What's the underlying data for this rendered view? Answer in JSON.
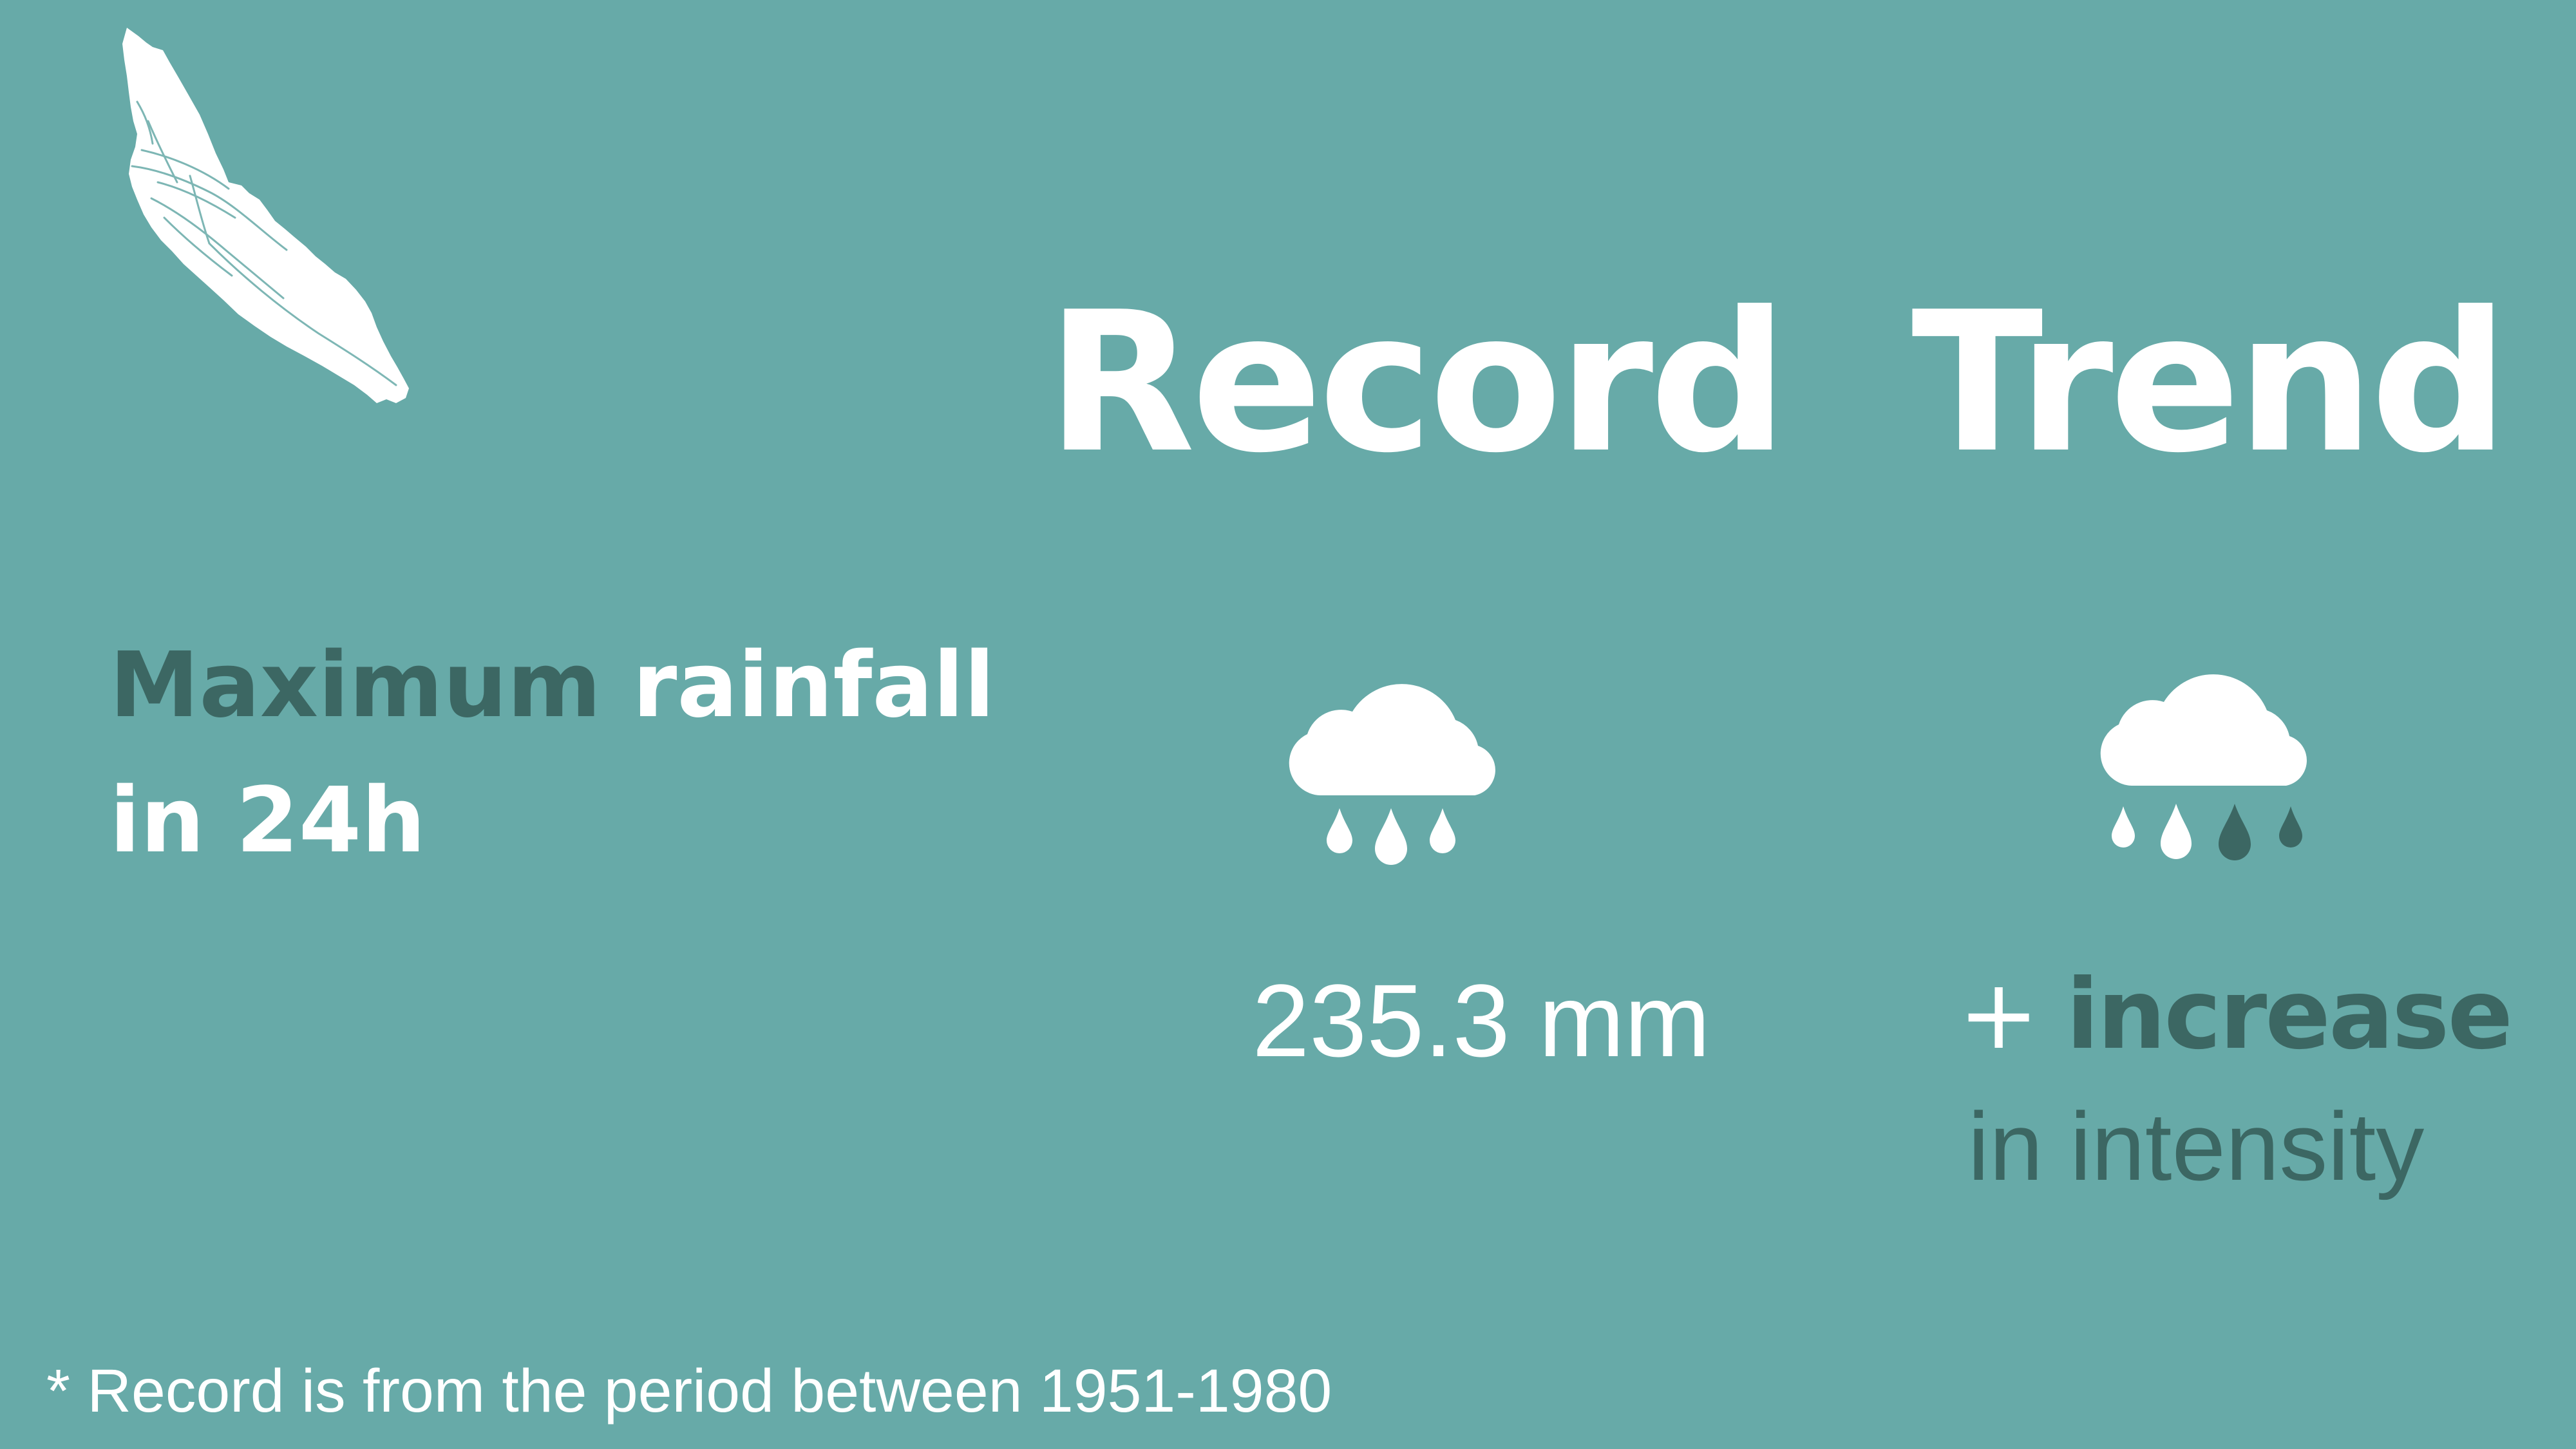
{
  "colors": {
    "background": "#67aaa8",
    "text_light": "#ffffff",
    "text_dark": "#3c6763"
  },
  "map": {
    "icon": "island-map-icon"
  },
  "headings": {
    "record": "Record",
    "trend": "Trend"
  },
  "metric": {
    "label_part1": "Maximum",
    "label_part2": "rainfall",
    "label_line2": "in 24h"
  },
  "record": {
    "icon": "rain-cloud-icon",
    "value": "235.3 mm"
  },
  "trend": {
    "icon": "rain-cloud-more-drops-icon",
    "sign": "+",
    "direction": "increase",
    "qualifier": "in intensity"
  },
  "footnote": {
    "marker": "*",
    "text": "Record is from the period between 1951-1980"
  }
}
